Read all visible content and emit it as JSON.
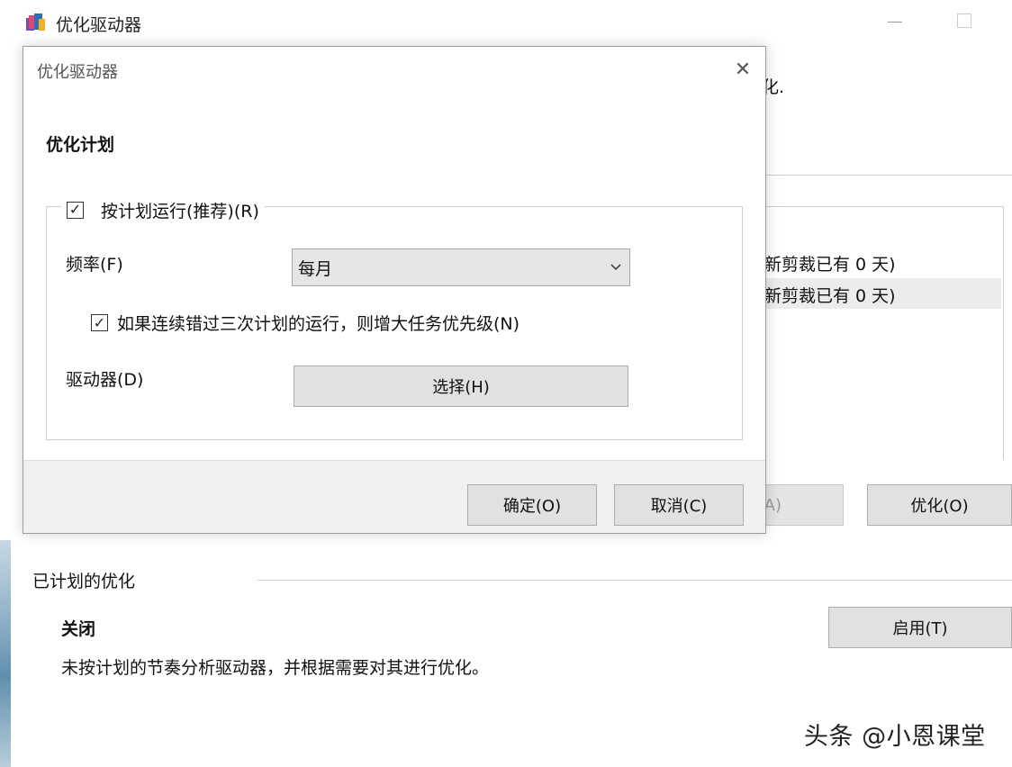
{
  "main": {
    "title": "优化驱动器",
    "snippet_top": "化.",
    "drive_rows": [
      "新剪裁已有 0 天)",
      "新剪裁已有 0 天)"
    ],
    "analyze_button": "A)",
    "optimize_button": "优化(O)",
    "scheduled": {
      "section_title": "已计划的优化",
      "status": "关闭",
      "description": "未按计划的节奏分析驱动器，并根据需要对其进行优化。",
      "enable_button": "启用(T)"
    },
    "watermark": "头条 @小恩课堂"
  },
  "dialog": {
    "title": "优化驱动器",
    "heading": "优化计划",
    "run_on_schedule": {
      "label": "按计划运行(推荐)(R)",
      "checked": true
    },
    "frequency": {
      "label": "频率(F)",
      "value": "每月"
    },
    "increase_priority": {
      "label": "如果连续错过三次计划的运行，则增大任务优先级(N)",
      "checked": true
    },
    "drives": {
      "label": "驱动器(D)",
      "button": "选择(H)"
    },
    "ok_button": "确定(O)",
    "cancel_button": "取消(C)"
  },
  "icons": {
    "close": "close-icon",
    "check": "checkmark-icon",
    "chevron": "chevron-down-icon",
    "app": "defrag-app-icon"
  }
}
